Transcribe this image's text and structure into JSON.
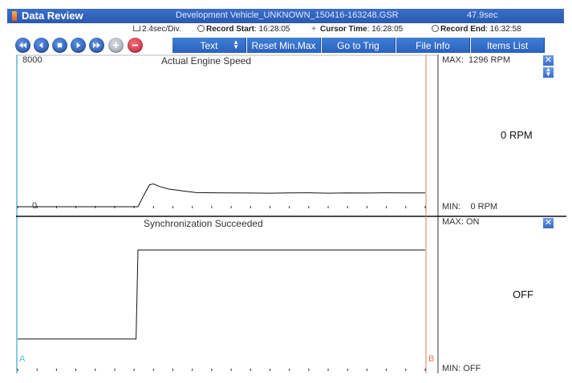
{
  "window": {
    "title": "Data Review",
    "file_name": "Development Vehicle_UNKNOWN_150416-163248.GSR",
    "duration": "47.9sec"
  },
  "info": {
    "div": "2.4sec/Div.",
    "record_start_label": "Record Start",
    "record_start_value": ": 16:28:05",
    "cursor_time_label": "Cursor Time",
    "cursor_time_value": ": 16:28:05",
    "record_end_label": "Record End",
    "record_end_value": ": 16:32:58"
  },
  "toolbar": {
    "playback": [
      "rewind-icon",
      "step-back-icon",
      "stop-icon",
      "play-icon",
      "fast-forward-icon"
    ],
    "text_button": "Text",
    "reset_button": "Reset Min.Max",
    "goto_trig_button": "Go to Trig",
    "file_info_button": "File Info",
    "items_list_button": "Items List",
    "colors": {
      "button": "#2f6ccb",
      "zoom_in": "#a0a7b0",
      "zoom_out": "#d6283f"
    }
  },
  "channels": [
    {
      "title": "Actual Engine Speed",
      "y_top_label": "8000",
      "y_zero_label": "0",
      "max_label": "MAX:",
      "max_value": "1296 RPM",
      "current_value": "0 RPM",
      "min_label": "MIN:",
      "min_value": "0 RPM",
      "color": "#111111"
    },
    {
      "title": "Synchronization Succeeded",
      "max_label": "MAX:",
      "max_value": "ON",
      "current_value": "OFF",
      "min_label": "MIN:",
      "min_value": "OFF",
      "color": "#111111"
    }
  ],
  "cursors": {
    "a_label": "A",
    "b_label": "B",
    "a_color": "#56b9d8",
    "b_color": "#e07a5a"
  },
  "chart_data": [
    {
      "type": "line",
      "title": "Actual Engine Speed",
      "ylabel": "RPM",
      "ylim": [
        0,
        8000
      ],
      "xlim": [
        0,
        21
      ],
      "series": [
        {
          "values": [
            [
              0,
              0
            ],
            [
              6.2,
              0
            ],
            [
              6.5,
              650
            ],
            [
              6.8,
              1250
            ],
            [
              7.0,
              1296
            ],
            [
              7.3,
              1150
            ],
            [
              7.8,
              1000
            ],
            [
              8.5,
              900
            ],
            [
              9.2,
              800
            ],
            [
              10,
              790
            ],
            [
              11,
              780
            ],
            [
              12,
              775
            ],
            [
              13,
              770
            ],
            [
              14,
              780
            ],
            [
              15,
              790
            ],
            [
              16,
              770
            ],
            [
              17,
              785
            ],
            [
              18,
              775
            ],
            [
              19,
              790
            ],
            [
              20,
              780
            ],
            [
              21,
              780
            ]
          ]
        }
      ]
    },
    {
      "type": "line",
      "title": "Synchronization Succeeded",
      "ylim": [
        0,
        1
      ],
      "xlim": [
        0,
        21
      ],
      "series": [
        {
          "values": [
            [
              0,
              0
            ],
            [
              6.1,
              0
            ],
            [
              6.2,
              1
            ],
            [
              21,
              1
            ]
          ]
        }
      ]
    }
  ]
}
